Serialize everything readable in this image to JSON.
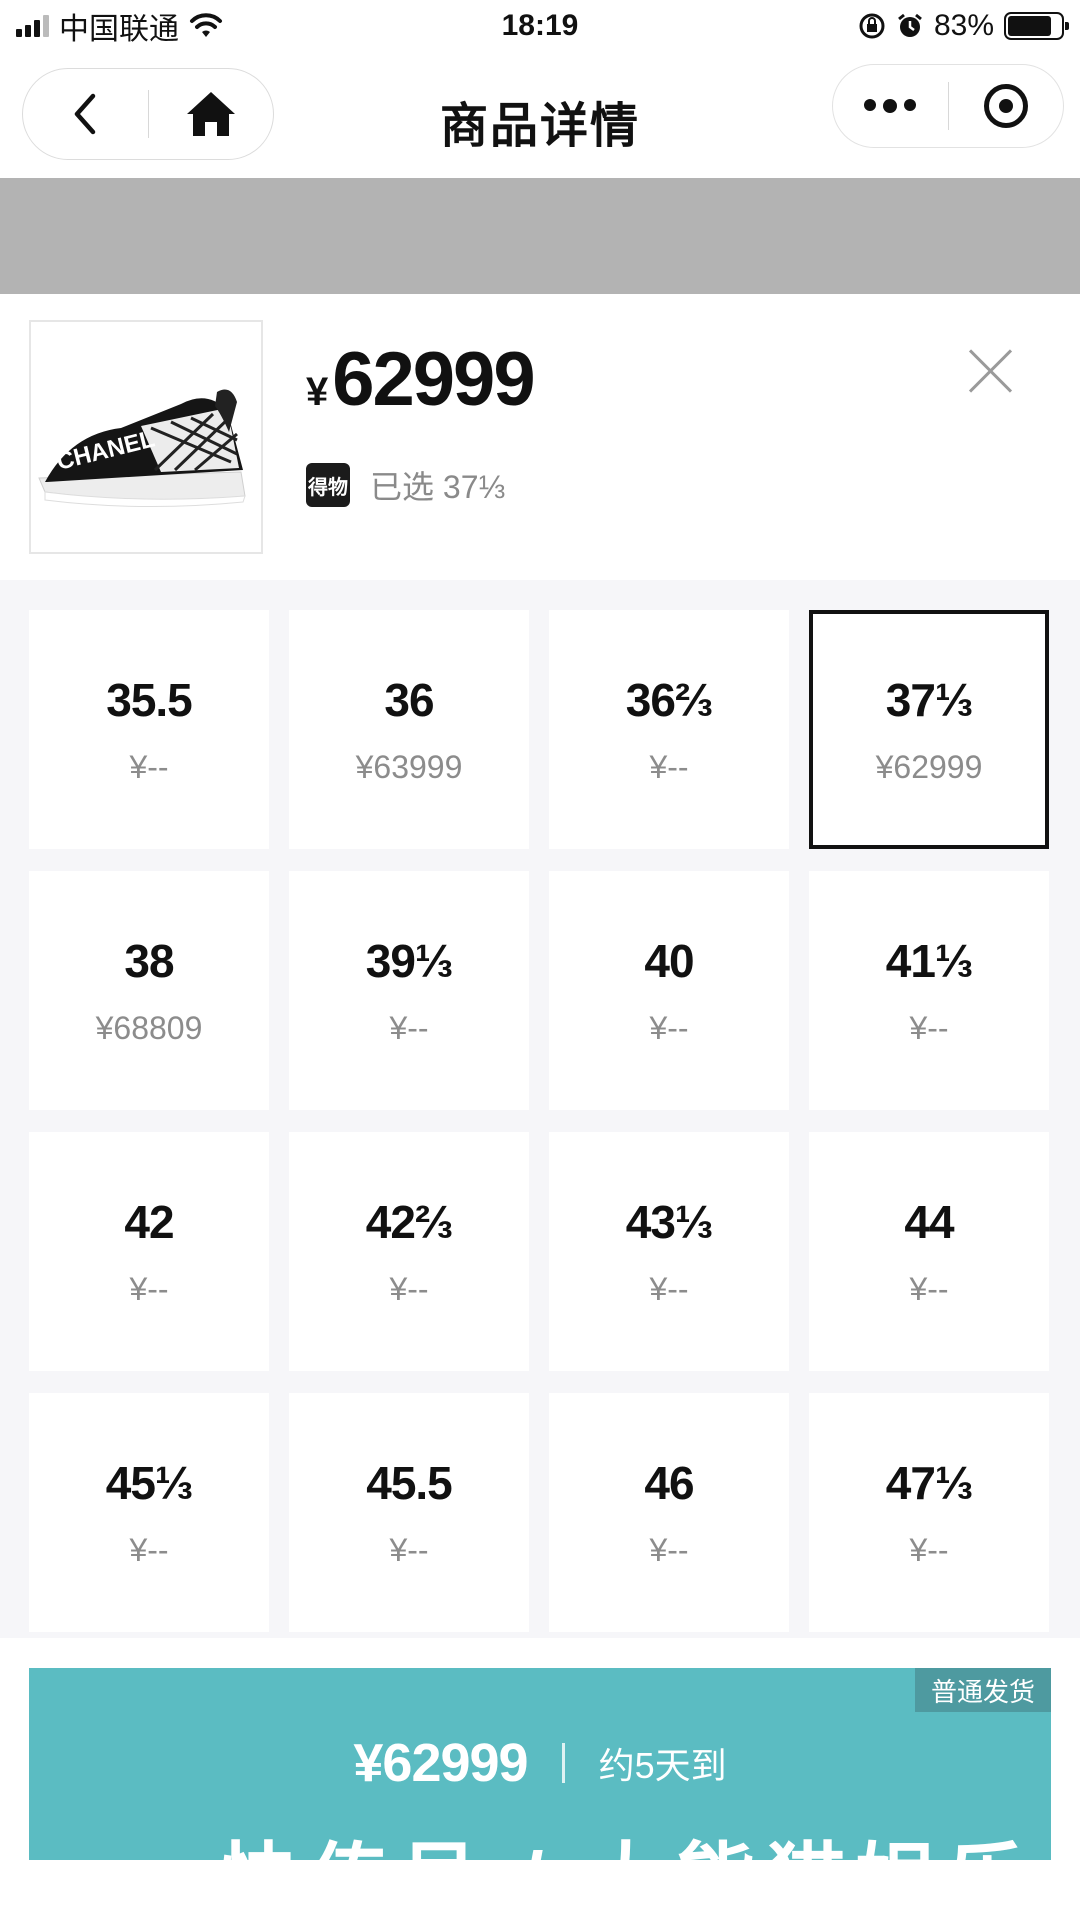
{
  "status_bar": {
    "carrier": "中国联通",
    "time": "18:19",
    "battery": "83%",
    "battery_level": 0.83
  },
  "nav": {
    "title": "商品详情"
  },
  "product": {
    "currency": "¥",
    "price": "62999",
    "brand_badge": "得物",
    "selected_text": "已选 37⅓"
  },
  "sizes": [
    {
      "label": "35.5",
      "price": "¥--"
    },
    {
      "label": "36",
      "price": "¥63999"
    },
    {
      "label": "36⅔",
      "price": "¥--"
    },
    {
      "label": "37⅓",
      "price": "¥62999",
      "selected": true
    },
    {
      "label": "38",
      "price": "¥68809"
    },
    {
      "label": "39⅓",
      "price": "¥--"
    },
    {
      "label": "40",
      "price": "¥--"
    },
    {
      "label": "41⅓",
      "price": "¥--"
    },
    {
      "label": "42",
      "price": "¥--"
    },
    {
      "label": "42⅔",
      "price": "¥--"
    },
    {
      "label": "43⅓",
      "price": "¥--"
    },
    {
      "label": "44",
      "price": "¥--"
    },
    {
      "label": "45⅓",
      "price": "¥--"
    },
    {
      "label": "45.5",
      "price": "¥--"
    },
    {
      "label": "46",
      "price": "¥--"
    },
    {
      "label": "47⅓",
      "price": "¥--"
    }
  ],
  "delivery": {
    "tag": "普通发货",
    "price": "¥62999",
    "eta": "约5天到",
    "tagline": "快传号 / 大熊猫娱乐"
  },
  "colors": {
    "accent_teal": "#5bbcc2",
    "tag_teal": "#4e9aa0",
    "grid_bg": "#f6f6f9"
  }
}
